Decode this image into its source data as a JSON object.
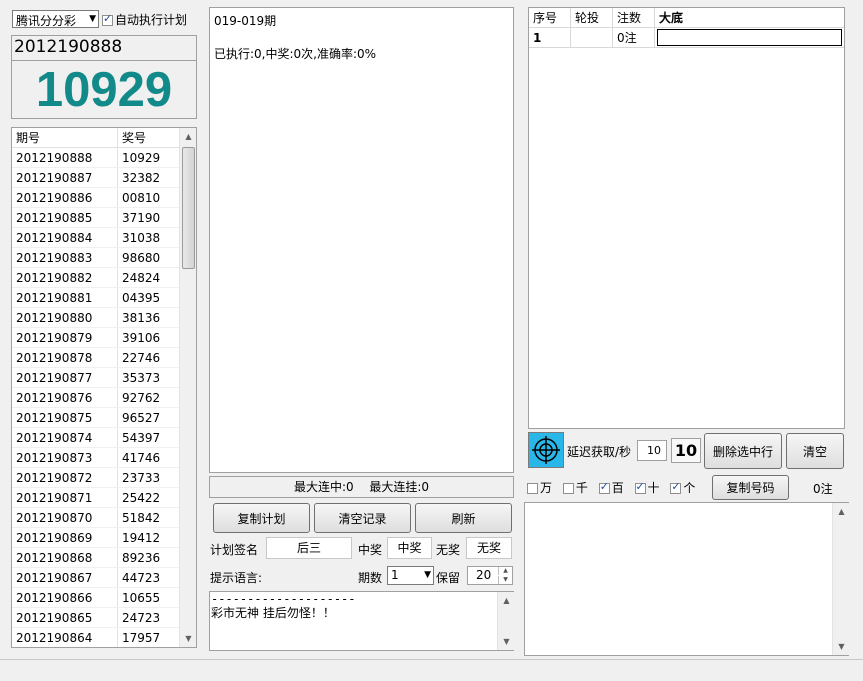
{
  "top": {
    "lottery_select": "腾讯分分彩",
    "auto_plan_label": "自动执行计划",
    "auto_plan_checked": true
  },
  "current": {
    "issue": "2012190888",
    "number": "10929"
  },
  "history": {
    "headers": [
      "期号",
      "奖号"
    ],
    "rows": [
      [
        "2012190888",
        "10929"
      ],
      [
        "2012190887",
        "32382"
      ],
      [
        "2012190886",
        "00810"
      ],
      [
        "2012190885",
        "37190"
      ],
      [
        "2012190884",
        "31038"
      ],
      [
        "2012190883",
        "98680"
      ],
      [
        "2012190882",
        "24824"
      ],
      [
        "2012190881",
        "04395"
      ],
      [
        "2012190880",
        "38136"
      ],
      [
        "2012190879",
        "39106"
      ],
      [
        "2012190878",
        "22746"
      ],
      [
        "2012190877",
        "35373"
      ],
      [
        "2012190876",
        "92762"
      ],
      [
        "2012190875",
        "96527"
      ],
      [
        "2012190874",
        "54397"
      ],
      [
        "2012190873",
        "41746"
      ],
      [
        "2012190872",
        "23733"
      ],
      [
        "2012190871",
        "25422"
      ],
      [
        "2012190870",
        "51842"
      ],
      [
        "2012190869",
        "19412"
      ],
      [
        "2012190868",
        "89236"
      ],
      [
        "2012190867",
        "44723"
      ],
      [
        "2012190866",
        "10655"
      ],
      [
        "2012190865",
        "24723"
      ],
      [
        "2012190864",
        "17957"
      ]
    ]
  },
  "plan_log": {
    "line1": "019-019期",
    "line2": "已执行:0,中奖:0次,准确率:0%"
  },
  "streak": {
    "max_win_label": "最大连中:",
    "max_win": "0",
    "max_lose_label": "最大连挂:",
    "max_lose": "0"
  },
  "buttons": {
    "copy_plan": "复制计划",
    "clear_log": "清空记录",
    "refresh": "刷新",
    "delete_selected": "删除选中行",
    "clear": "清空",
    "copy_numbers": "复制号码"
  },
  "plan_form": {
    "sig_label": "计划签名",
    "sig_value": "后三",
    "win_label": "中奖",
    "win_value": "中奖",
    "nowin_label": "无奖",
    "nowin_value": "无奖",
    "hint_label": "提示语言:",
    "periods_label": "期数",
    "periods_value": "1",
    "keep_label": "保留",
    "keep_value": "20"
  },
  "hint_text": {
    "line1": "--------------------",
    "line2": "彩市无神 挂后勿怪！！"
  },
  "bet_table": {
    "headers": [
      "序号",
      "轮投",
      "注数",
      "大底"
    ],
    "row": {
      "index": "1",
      "round": "",
      "count": "0注",
      "base": ""
    }
  },
  "delay": {
    "label": "延迟获取/秒",
    "value": "10",
    "display": "10"
  },
  "digits": {
    "items": [
      {
        "label": "万",
        "checked": false
      },
      {
        "label": "千",
        "checked": false
      },
      {
        "label": "百",
        "checked": true
      },
      {
        "label": "十",
        "checked": true
      },
      {
        "label": "个",
        "checked": true
      }
    ],
    "count": "0注"
  },
  "colors": {
    "big_number": "#138a8a",
    "target_icon_bg": "#29b6e8"
  }
}
